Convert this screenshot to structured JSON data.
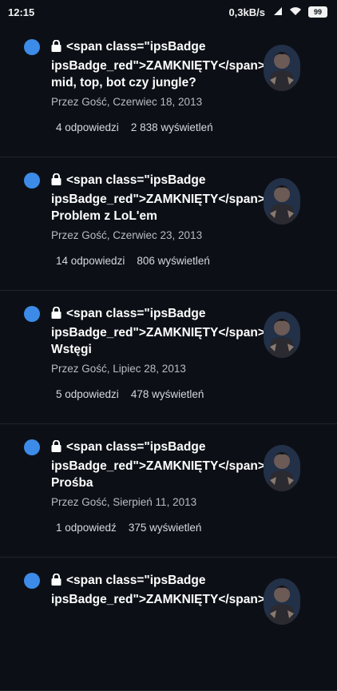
{
  "status_bar": {
    "time": "12:15",
    "speed": "0,3kB/s",
    "battery": "99"
  },
  "topics": [
    {
      "title": "<span class=\"ipsBadge ipsBadge_red\">ZAMKNIĘTY</span> mid, top, bot czy jungle?",
      "meta": "Przez Gość, Czerwiec 18, 2013",
      "replies": "4 odpowiedzi",
      "views": "2 838 wyświetleń"
    },
    {
      "title": "<span class=\"ipsBadge ipsBadge_red\">ZAMKNIĘTY</span> Problem z LoL'em",
      "meta": "Przez Gość, Czerwiec 23, 2013",
      "replies": "14 odpowiedzi",
      "views": "806 wyświetleń"
    },
    {
      "title": "<span class=\"ipsBadge ipsBadge_red\">ZAMKNIĘTY</span> Wstęgi",
      "meta": "Przez Gość, Lipiec 28, 2013",
      "replies": "5 odpowiedzi",
      "views": "478 wyświetleń"
    },
    {
      "title": "<span class=\"ipsBadge ipsBadge_red\">ZAMKNIĘTY</span> Prośba",
      "meta": "Przez Gość, Sierpień 11, 2013",
      "replies": "1 odpowiedź",
      "views": "375 wyświetleń"
    },
    {
      "title": "<span class=\"ipsBadge ipsBadge_red\">ZAMKNIĘTY</span>",
      "meta": "",
      "replies": "",
      "views": ""
    }
  ]
}
